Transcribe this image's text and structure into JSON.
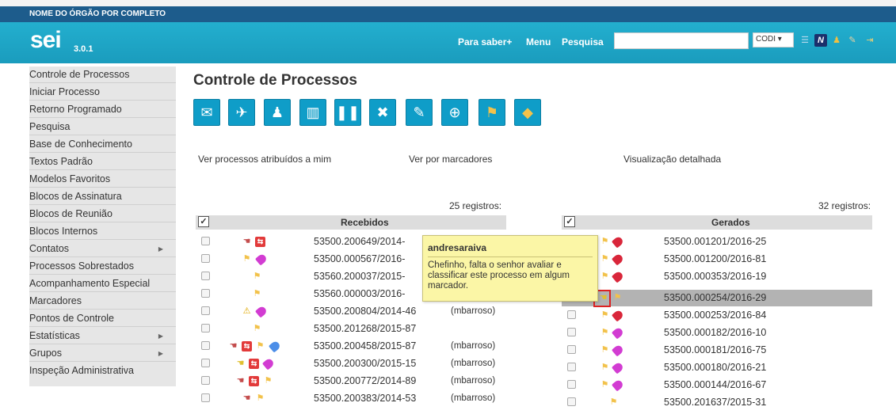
{
  "header": {
    "org_name": "NOME DO ÓRGÃO POR COMPLETO",
    "logo": "sei",
    "version": "3.0.1",
    "nav": [
      "Para saber+",
      "Menu",
      "Pesquisa"
    ],
    "search_value": "",
    "unit_select": "CODI ▾",
    "icons": [
      "list-icon",
      "n-icon",
      "user-icon",
      "wrench-icon",
      "exit-icon"
    ]
  },
  "sidebar": {
    "items": [
      {
        "label": "Controle de Processos",
        "submenu": false
      },
      {
        "label": "Iniciar Processo",
        "submenu": false
      },
      {
        "label": "Retorno Programado",
        "submenu": false
      },
      {
        "label": "Pesquisa",
        "submenu": false
      },
      {
        "label": "Base de Conhecimento",
        "submenu": false
      },
      {
        "label": "Textos Padrão",
        "submenu": false
      },
      {
        "label": "Modelos Favoritos",
        "submenu": false
      },
      {
        "label": "Blocos de Assinatura",
        "submenu": false
      },
      {
        "label": "Blocos de Reunião",
        "submenu": false
      },
      {
        "label": "Blocos Internos",
        "submenu": false
      },
      {
        "label": "Contatos",
        "submenu": true
      },
      {
        "label": "Processos Sobrestados",
        "submenu": false
      },
      {
        "label": "Acompanhamento Especial",
        "submenu": false
      },
      {
        "label": "Marcadores",
        "submenu": false
      },
      {
        "label": "Pontos de Controle",
        "submenu": false
      },
      {
        "label": "Estatísticas",
        "submenu": true
      },
      {
        "label": "Grupos",
        "submenu": true
      },
      {
        "label": "Inspeção Administrativa",
        "submenu": false
      }
    ]
  },
  "main": {
    "title": "Controle de Processos",
    "toolbar": [
      "send-process-icon",
      "update-progress-icon",
      "assign-process-icon",
      "include-block-icon",
      "suspend-icon",
      "close-process-icon",
      "annotations-icon",
      "new-document-icon",
      "flag-icon",
      "marker-tag-icon"
    ],
    "links": {
      "assigned": "Ver processos atribuídos a mim",
      "markers": "Ver por marcadores",
      "detailed": "Visualização detalhada"
    },
    "received": {
      "count": "25 registros:",
      "header": "Recebidos",
      "rows": [
        {
          "number": "53500.200649/2014-",
          "user": ""
        },
        {
          "number": "53500.000567/2016-",
          "user": ""
        },
        {
          "number": "53560.200037/2015-",
          "user": ""
        },
        {
          "number": "53560.000003/2016-",
          "user": ""
        },
        {
          "number": "53500.200804/2014-46",
          "user": "(mbarroso)"
        },
        {
          "number": "53500.201268/2015-87",
          "user": ""
        },
        {
          "number": "53500.200458/2015-87",
          "user": "(mbarroso)"
        },
        {
          "number": "53500.200300/2015-15",
          "user": "(mbarroso)"
        },
        {
          "number": "53500.200772/2014-89",
          "user": "(mbarroso)"
        },
        {
          "number": "53500.200383/2014-53",
          "user": "(mbarroso)"
        }
      ]
    },
    "generated": {
      "count": "32 registros:",
      "header": "Gerados",
      "rows": [
        {
          "number": "53500.001201/2016-25"
        },
        {
          "number": "53500.001200/2016-81"
        },
        {
          "number": "53500.000353/2016-19"
        },
        {
          "number": "53500.000254/2016-29"
        },
        {
          "number": "53500.000253/2016-84"
        },
        {
          "number": "53500.000182/2016-10"
        },
        {
          "number": "53500.000181/2016-75"
        },
        {
          "number": "53500.000180/2016-21"
        },
        {
          "number": "53500.000144/2016-67"
        },
        {
          "number": "53500.201637/2015-31"
        }
      ]
    },
    "tooltip": {
      "user": "andresaraiva",
      "text": "Chefinho, falta o senhor avaliar e classificar este processo em algum marcador."
    }
  },
  "colors": {
    "org_bar": "#1d5c8c",
    "header_bar": "#1aa7c7",
    "toolbar_button": "#0f9dc8",
    "selected_row": "#b3b3b3",
    "tooltip_bg": "#fbf6a6"
  }
}
